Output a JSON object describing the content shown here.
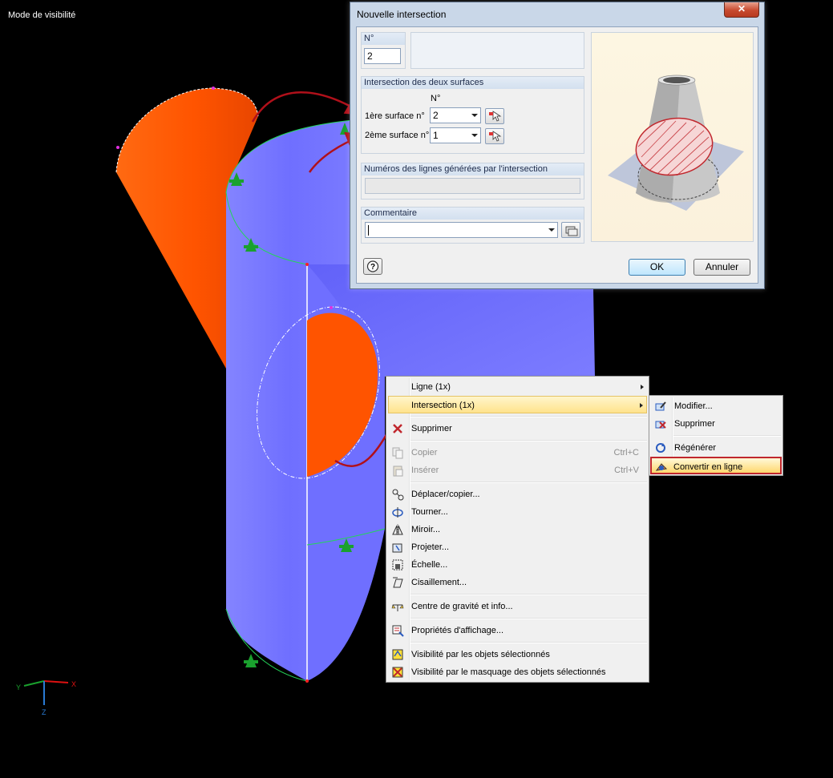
{
  "viewport": {
    "mode_label": "Mode de visibilité",
    "axes": {
      "x": "X",
      "y": "Y",
      "z": "Z"
    }
  },
  "dialog": {
    "title": "Nouvelle intersection",
    "close_label": "✕",
    "number_group": {
      "label": "N°",
      "value": "2"
    },
    "surfaces_group": {
      "header": "Intersection des deux surfaces",
      "column_label": "N°",
      "surface1_label": "1ère surface n°",
      "surface1_value": "2",
      "surface2_label": "2ème surface n°",
      "surface2_value": "1"
    },
    "lines_group": {
      "header": "Numéros des lignes générées par l'intersection",
      "value": ""
    },
    "comment_group": {
      "header": "Commentaire",
      "value": ""
    },
    "ok_label": "OK",
    "cancel_label": "Annuler"
  },
  "context_menu": {
    "items": [
      {
        "label": "Ligne (1x)",
        "submenu": true
      },
      {
        "label": "Intersection (1x)",
        "submenu": true,
        "highlighted": true
      },
      {
        "label": "Supprimer"
      },
      {
        "label": "Copier",
        "shortcut": "Ctrl+C",
        "disabled": true
      },
      {
        "label": "Insérer",
        "shortcut": "Ctrl+V",
        "disabled": true
      },
      {
        "label": "Déplacer/copier..."
      },
      {
        "label": "Tourner..."
      },
      {
        "label": "Miroir..."
      },
      {
        "label": "Projeter..."
      },
      {
        "label": "Échelle..."
      },
      {
        "label": "Cisaillement..."
      },
      {
        "label": "Centre de gravité et info..."
      },
      {
        "label": "Propriétés d'affichage..."
      },
      {
        "label": "Visibilité par les objets sélectionnés"
      },
      {
        "label": "Visibilité par le masquage des objets sélectionnés"
      }
    ]
  },
  "submenu": {
    "items": [
      {
        "label": "Modifier..."
      },
      {
        "label": "Supprimer"
      },
      {
        "label": "Régénérer"
      },
      {
        "label": "Convertir en ligne",
        "selected": true
      }
    ]
  },
  "colors": {
    "surface_orange": "#ff5a00",
    "surface_blue": "#7b7bff",
    "support_green": "#1aa12e",
    "arrow_red": "#b0101a"
  }
}
